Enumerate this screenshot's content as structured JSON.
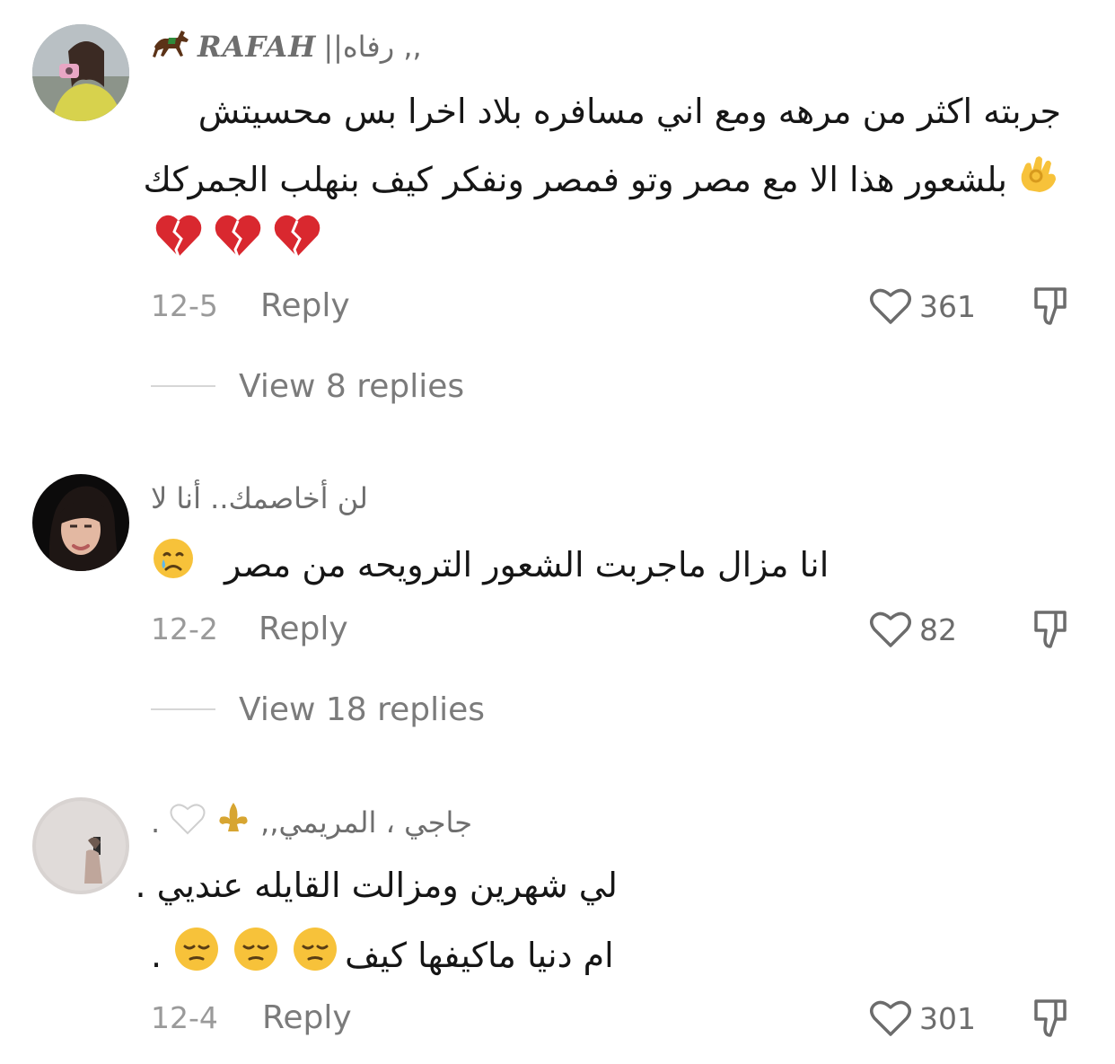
{
  "comments": [
    {
      "username_latin": "RAFAH",
      "username_arabic": "||رفاه ,,",
      "lines": [
        "جربته اكثر من مرهه ومع اني مسافره بلاد اخرا بس محسيتش",
        "بلشعور هذا الا مع مصر وتو فمصر ونفكر كيف بنهلب الجمركك",
        ""
      ],
      "emojis": [
        "ok-hand",
        "broken-heart",
        "broken-heart",
        "broken-heart"
      ],
      "date": "12-5",
      "reply": "Reply",
      "likes": "361",
      "view_replies": "View 8 replies"
    },
    {
      "username": "لن أخاصمك.. أنا لا",
      "lines": [
        "انا مزال ماجربت الشعور الترويحه من مصر"
      ],
      "emojis": [
        "crying-face"
      ],
      "date": "12-2",
      "reply": "Reply",
      "likes": "82",
      "view_replies": "View 18 replies"
    },
    {
      "username": ",,جاجي ، المريمي",
      "username_suffix": ".",
      "lines": [
        "لي شهرين ومزالت القايله عنديي .",
        "ام دنيا ماكيفها كيف",
        "."
      ],
      "emojis": [
        "fleur-de-lis",
        "white-heart",
        "pensive-face",
        "pensive-face",
        "pensive-face"
      ],
      "date": "12-4",
      "reply": "Reply",
      "likes": "301"
    }
  ],
  "colors": {
    "text": "#161616",
    "muted": "#7b7b7b",
    "date": "#9a9a9a",
    "broken_heart": "#d9282f",
    "emoji_yellow": "#f7c23a"
  }
}
